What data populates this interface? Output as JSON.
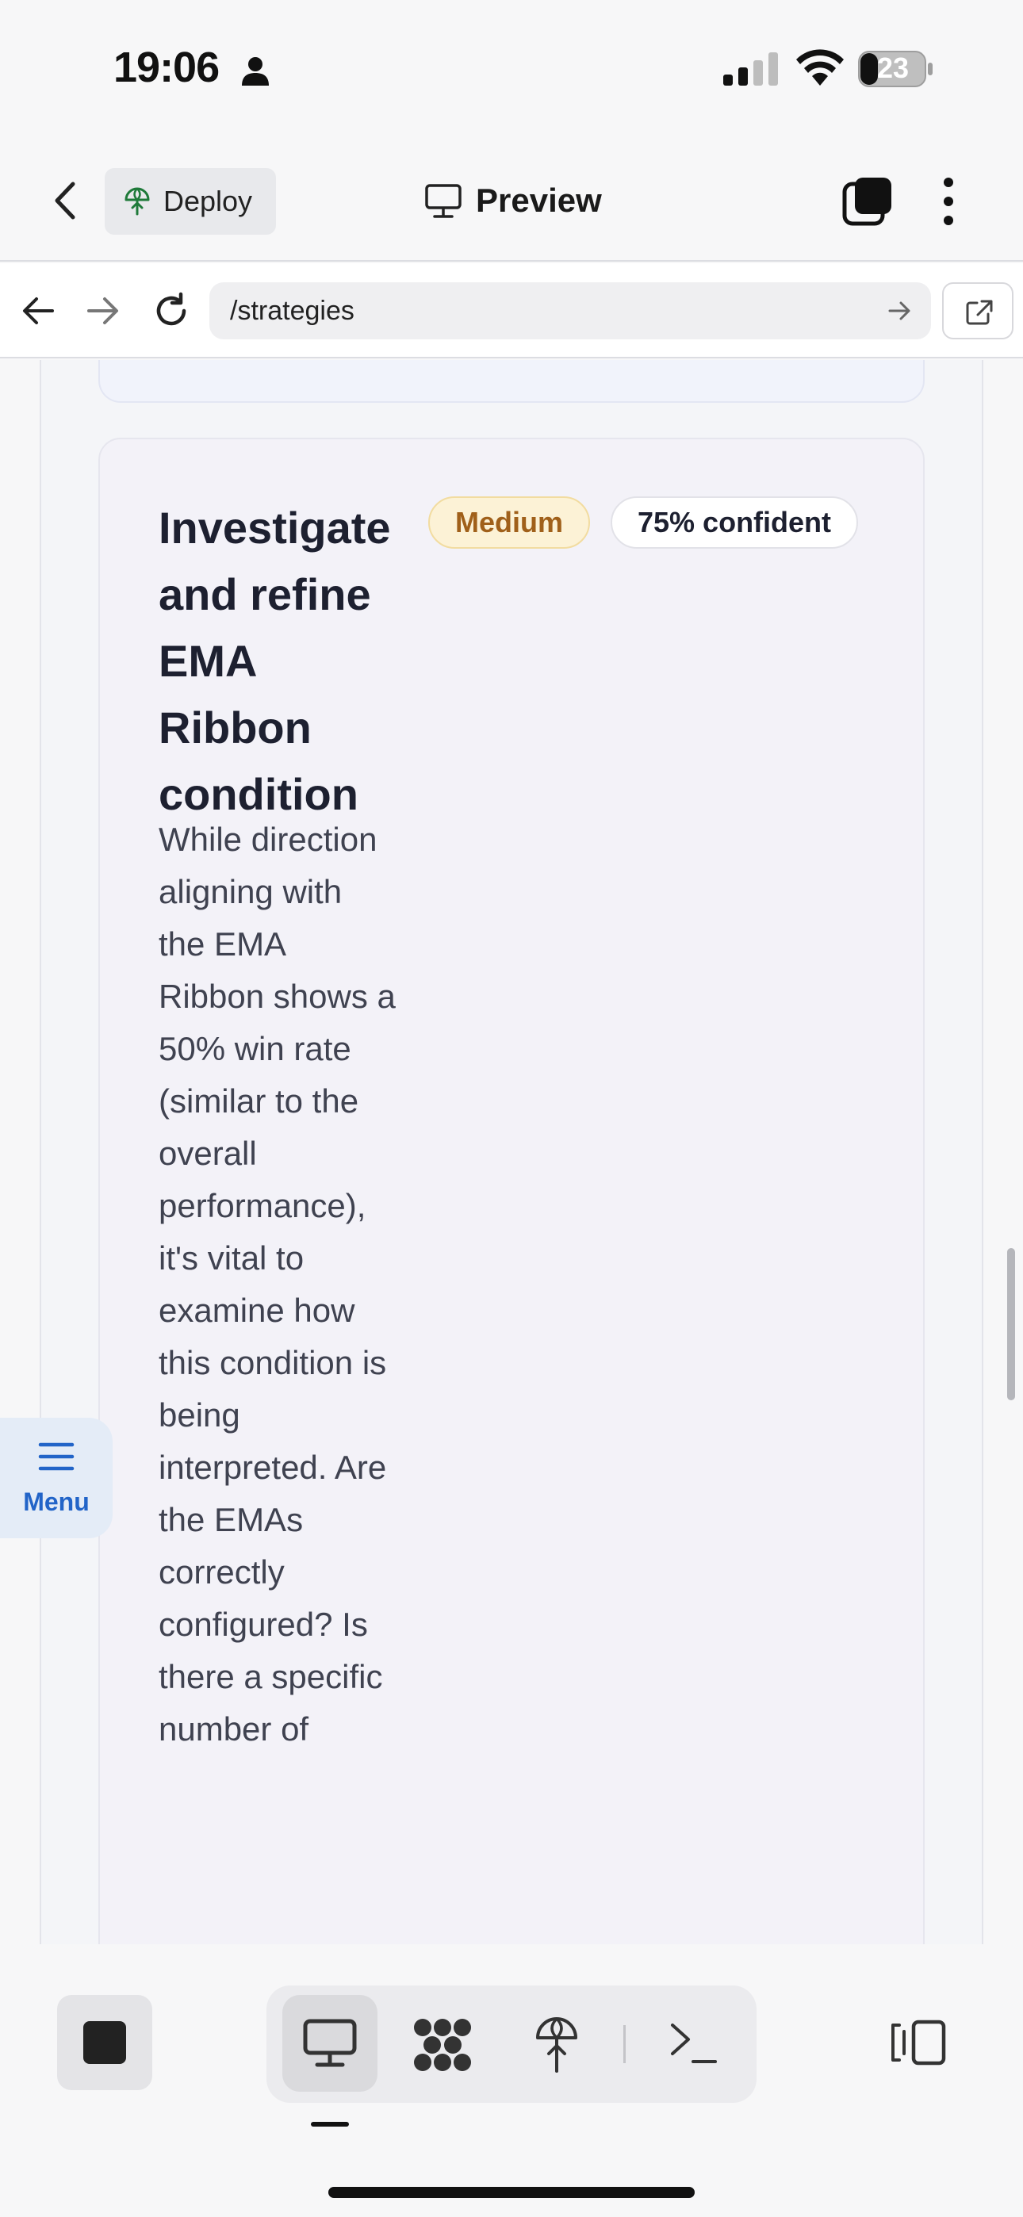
{
  "status_bar": {
    "time": "19:06",
    "battery": "23"
  },
  "header": {
    "deploy_label": "Deploy",
    "preview_label": "Preview"
  },
  "url_bar": {
    "url": "/strategies"
  },
  "recommendation": {
    "title": "Investigate and refine EMA Ribbon condition",
    "priority_badge": "Medium",
    "confidence_badge": "75% confident",
    "body": "While direction aligning with the EMA Ribbon shows a 50% win rate (similar to the overall performance), it's vital to examine how this condition is being interpreted. Are the EMAs correctly configured? Is there a specific number of"
  },
  "floating_menu": {
    "label": "Menu"
  },
  "colors": {
    "medium_badge_bg": "#fcf2d6",
    "medium_badge_text": "#a0601a",
    "menu_accent": "#2264c8"
  }
}
